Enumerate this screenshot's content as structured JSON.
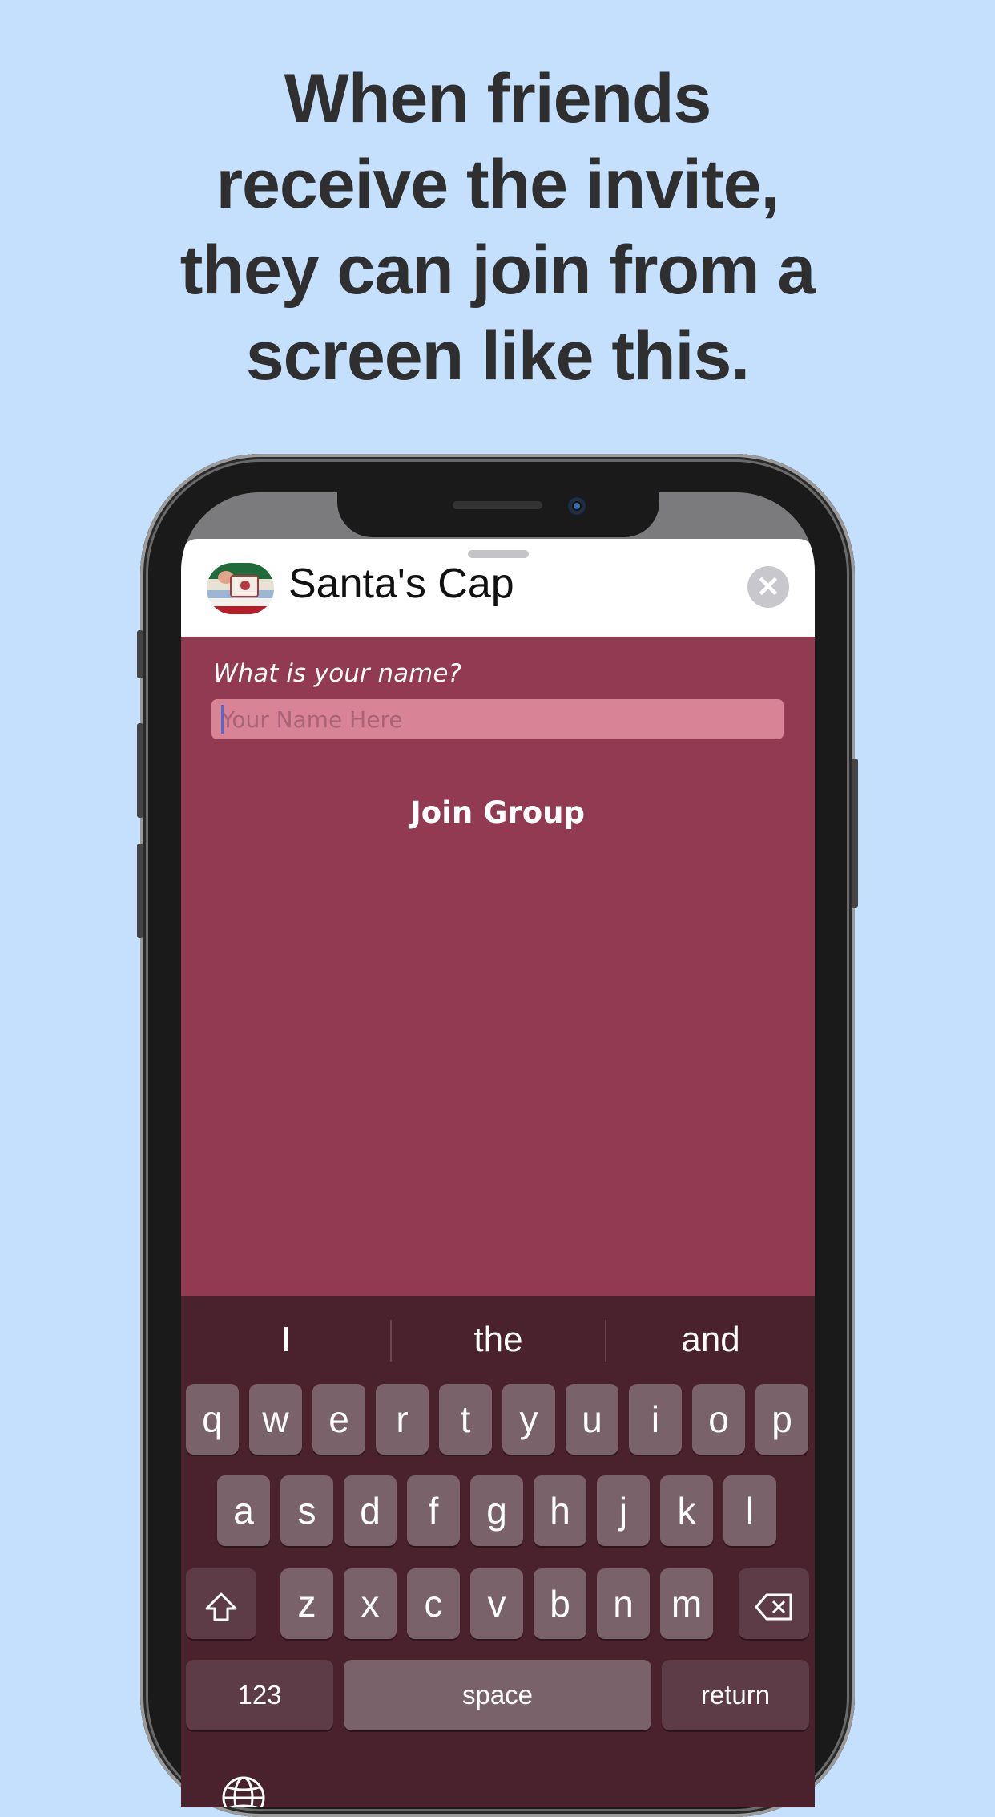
{
  "headline": {
    "lines": [
      "When friends",
      "receive the invite,",
      "they can join from a",
      "screen like this."
    ]
  },
  "sheet": {
    "title": "Santa's Cap",
    "close_symbol": "✕",
    "name_label": "What is your name?",
    "name_placeholder": "Your Name Here",
    "name_value": "",
    "join_label": "Join Group"
  },
  "keyboard": {
    "suggestions": [
      "I",
      "the",
      "and"
    ],
    "row1": [
      "q",
      "w",
      "e",
      "r",
      "t",
      "y",
      "u",
      "i",
      "o",
      "p"
    ],
    "row2": [
      "a",
      "s",
      "d",
      "f",
      "g",
      "h",
      "j",
      "k",
      "l"
    ],
    "row3": [
      "z",
      "x",
      "c",
      "v",
      "b",
      "n",
      "m"
    ],
    "numbers_label": "123",
    "space_label": "space",
    "return_label": "return",
    "shift_icon": "shift-icon",
    "delete_icon": "delete-icon",
    "globe_icon": "globe-icon"
  },
  "colors": {
    "background": "#c5e0fc",
    "sheet": "#923a51",
    "input": "#d98396",
    "keyboard": "#4a222e",
    "key": "#7a626a",
    "key_dark": "#5d3c48"
  }
}
